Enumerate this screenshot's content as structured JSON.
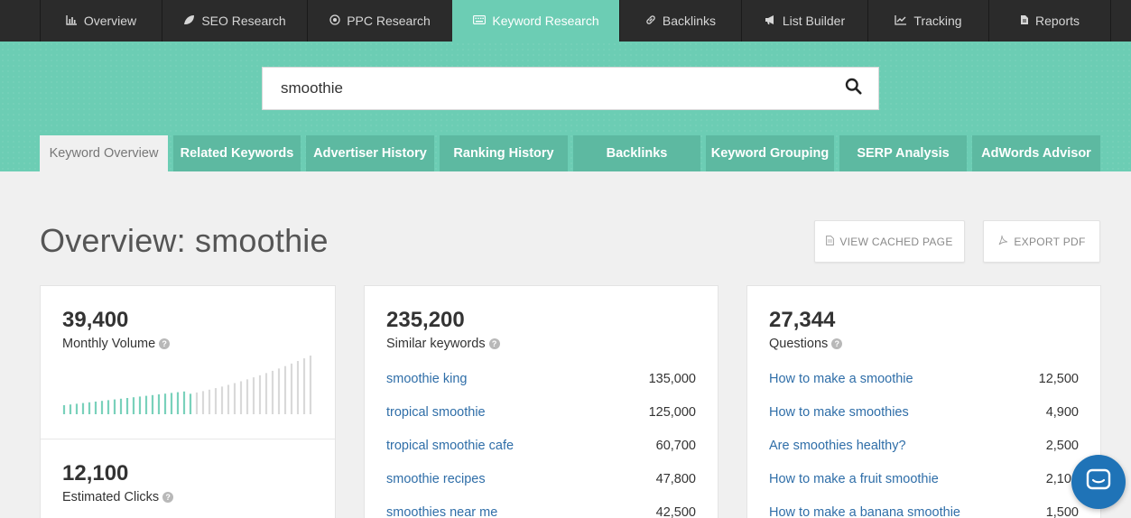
{
  "nav": {
    "items": [
      {
        "label": "Overview",
        "icon": "bar-chart-icon"
      },
      {
        "label": "SEO Research",
        "icon": "leaf-icon"
      },
      {
        "label": "PPC Research",
        "icon": "target-icon"
      },
      {
        "label": "Keyword Research",
        "icon": "keyboard-icon"
      },
      {
        "label": "Backlinks",
        "icon": "link-icon"
      },
      {
        "label": "List Builder",
        "icon": "megaphone-icon"
      },
      {
        "label": "Tracking",
        "icon": "line-chart-icon"
      },
      {
        "label": "Reports",
        "icon": "document-icon"
      }
    ],
    "active": "Keyword Research"
  },
  "search": {
    "value": "smoothie"
  },
  "subtabs": [
    "Keyword Overview",
    "Related Keywords",
    "Advertiser History",
    "Ranking History",
    "Backlinks",
    "Keyword Grouping",
    "SERP Analysis",
    "AdWords Advisor"
  ],
  "header": {
    "title": "Overview: smoothie",
    "cached_label": "VIEW CACHED PAGE",
    "export_label": "EXPORT PDF"
  },
  "volume_card": {
    "value": "39,400",
    "label": "Monthly Volume",
    "clicks_value": "12,100",
    "clicks_label": "Estimated Clicks"
  },
  "similar_card": {
    "value": "235,200",
    "label": "Similar keywords",
    "rows": [
      {
        "keyword": "smoothie king",
        "volume": "135,000"
      },
      {
        "keyword": "tropical smoothie",
        "volume": "125,000"
      },
      {
        "keyword": "tropical smoothie cafe",
        "volume": "60,700"
      },
      {
        "keyword": "smoothie recipes",
        "volume": "47,800"
      },
      {
        "keyword": "smoothies near me",
        "volume": "42,500"
      }
    ]
  },
  "questions_card": {
    "value": "27,344",
    "label": "Questions",
    "rows": [
      {
        "keyword": "How to make a smoothie",
        "volume": "12,500"
      },
      {
        "keyword": "How to make smoothies",
        "volume": "4,900"
      },
      {
        "keyword": "Are smoothies healthy?",
        "volume": "2,500"
      },
      {
        "keyword": "How to make a fruit smoothie",
        "volume": "2,100"
      },
      {
        "keyword": "How to make a banana smoothie",
        "volume": "1,500"
      }
    ]
  },
  "colors": {
    "accent": "#6ccdb4",
    "link": "#2f6ea8",
    "spark_teal": "#79d1bb",
    "spark_gray": "#d9d9d9",
    "chat": "#1f73b7"
  }
}
